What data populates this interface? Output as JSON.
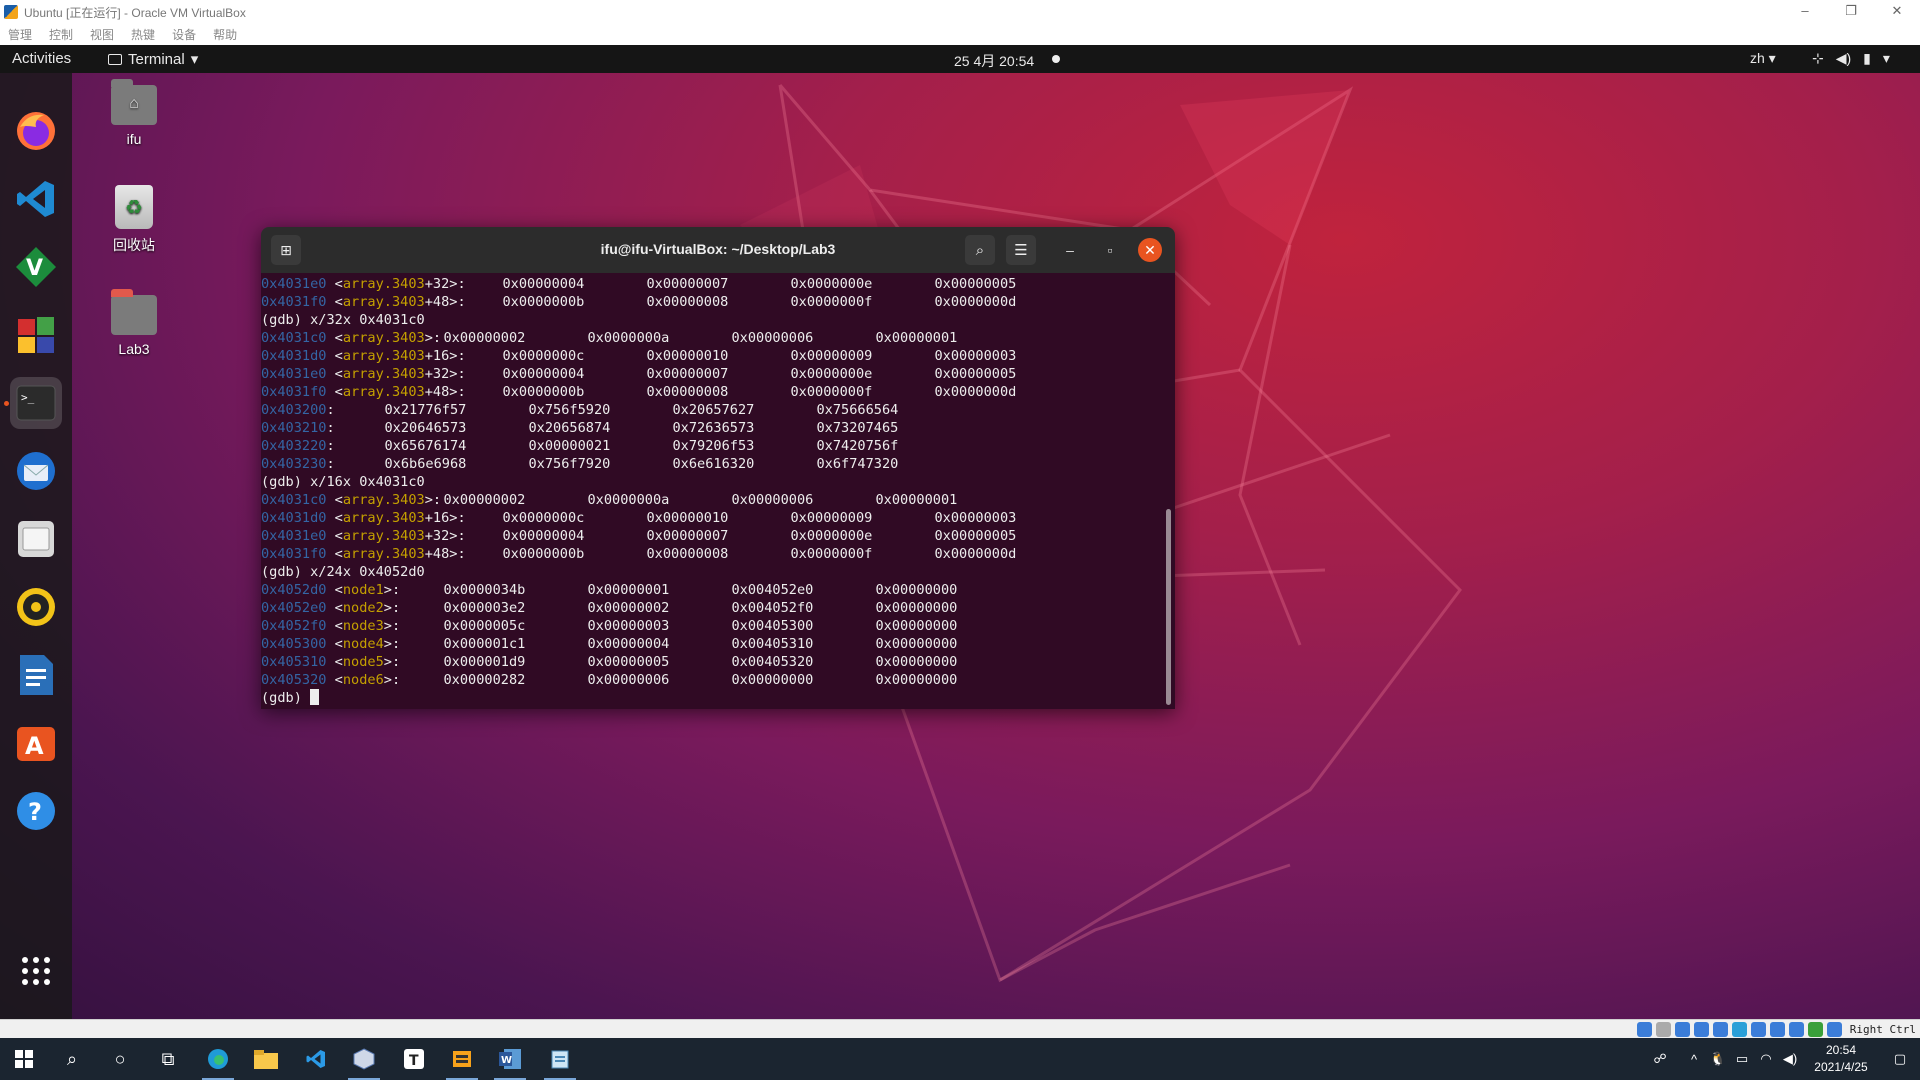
{
  "vbox": {
    "title": "Ubuntu [正在运行] - Oracle VM VirtualBox",
    "menu": [
      "管理",
      "控制",
      "视图",
      "热键",
      "设备",
      "帮助"
    ],
    "window_buttons": {
      "minimize": "–",
      "restore": "❐",
      "close": "✕"
    }
  },
  "topbar": {
    "activities": "Activities",
    "app_menu": "Terminal",
    "clock": "25 4月  20:54",
    "lang": "zh"
  },
  "dock": {
    "items": [
      "firefox-icon",
      "vscode-icon",
      "vim-icon",
      "office-icon",
      "terminal-icon",
      "thunderbird-icon",
      "files-icon",
      "rhythmbox-icon",
      "writer-icon",
      "software-icon",
      "help-icon",
      "show-apps-icon"
    ]
  },
  "desktop": {
    "icons": [
      {
        "label": "ifu"
      },
      {
        "label": "回收站"
      },
      {
        "label": "Lab3"
      }
    ]
  },
  "terminal": {
    "title": "ifu@ifu-VirtualBox: ~/Desktop/Lab3",
    "lines": [
      {
        "addr": "0x4031e0",
        "sym": "array.3403",
        "off": "+32",
        "vals": [
          "0x00000004",
          "0x00000007",
          "0x0000000e",
          "0x00000005"
        ]
      },
      {
        "addr": "0x4031f0",
        "sym": "array.3403",
        "off": "+48",
        "vals": [
          "0x0000000b",
          "0x00000008",
          "0x0000000f",
          "0x0000000d"
        ]
      },
      {
        "cmd": "(gdb) x/32x 0x4031c0"
      },
      {
        "addr": "0x4031c0",
        "sym": "array.3403",
        "off": "",
        "vals": [
          "0x00000002",
          "0x0000000a",
          "0x00000006",
          "0x00000001"
        ]
      },
      {
        "addr": "0x4031d0",
        "sym": "array.3403",
        "off": "+16",
        "vals": [
          "0x0000000c",
          "0x00000010",
          "0x00000009",
          "0x00000003"
        ]
      },
      {
        "addr": "0x4031e0",
        "sym": "array.3403",
        "off": "+32",
        "vals": [
          "0x00000004",
          "0x00000007",
          "0x0000000e",
          "0x00000005"
        ]
      },
      {
        "addr": "0x4031f0",
        "sym": "array.3403",
        "off": "+48",
        "vals": [
          "0x0000000b",
          "0x00000008",
          "0x0000000f",
          "0x0000000d"
        ]
      },
      {
        "addr": "0x403200",
        "plain": true,
        "vals": [
          "0x21776f57",
          "0x756f5920",
          "0x20657627",
          "0x75666564"
        ]
      },
      {
        "addr": "0x403210",
        "plain": true,
        "vals": [
          "0x20646573",
          "0x20656874",
          "0x72636573",
          "0x73207465"
        ]
      },
      {
        "addr": "0x403220",
        "plain": true,
        "vals": [
          "0x65676174",
          "0x00000021",
          "0x79206f53",
          "0x7420756f"
        ]
      },
      {
        "addr": "0x403230",
        "plain": true,
        "vals": [
          "0x6b6e6968",
          "0x756f7920",
          "0x6e616320",
          "0x6f747320"
        ]
      },
      {
        "cmd": "(gdb) x/16x 0x4031c0"
      },
      {
        "addr": "0x4031c0",
        "sym": "array.3403",
        "off": "",
        "vals": [
          "0x00000002",
          "0x0000000a",
          "0x00000006",
          "0x00000001"
        ]
      },
      {
        "addr": "0x4031d0",
        "sym": "array.3403",
        "off": "+16",
        "vals": [
          "0x0000000c",
          "0x00000010",
          "0x00000009",
          "0x00000003"
        ]
      },
      {
        "addr": "0x4031e0",
        "sym": "array.3403",
        "off": "+32",
        "vals": [
          "0x00000004",
          "0x00000007",
          "0x0000000e",
          "0x00000005"
        ]
      },
      {
        "addr": "0x4031f0",
        "sym": "array.3403",
        "off": "+48",
        "vals": [
          "0x0000000b",
          "0x00000008",
          "0x0000000f",
          "0x0000000d"
        ]
      },
      {
        "cmd": "(gdb) x/24x 0x4052d0"
      },
      {
        "addr": "0x4052d0",
        "sym": "node1",
        "off": "",
        "vals": [
          "0x0000034b",
          "0x00000001",
          "0x004052e0",
          "0x00000000"
        ]
      },
      {
        "addr": "0x4052e0",
        "sym": "node2",
        "off": "",
        "vals": [
          "0x000003e2",
          "0x00000002",
          "0x004052f0",
          "0x00000000"
        ]
      },
      {
        "addr": "0x4052f0",
        "sym": "node3",
        "off": "",
        "vals": [
          "0x0000005c",
          "0x00000003",
          "0x00405300",
          "0x00000000"
        ]
      },
      {
        "addr": "0x405300",
        "sym": "node4",
        "off": "",
        "vals": [
          "0x000001c1",
          "0x00000004",
          "0x00405310",
          "0x00000000"
        ]
      },
      {
        "addr": "0x405310",
        "sym": "node5",
        "off": "",
        "vals": [
          "0x000001d9",
          "0x00000005",
          "0x00405320",
          "0x00000000"
        ]
      },
      {
        "addr": "0x405320",
        "sym": "node6",
        "off": "",
        "vals": [
          "0x00000282",
          "0x00000006",
          "0x00000000",
          "0x00000000"
        ]
      }
    ],
    "prompt": "(gdb) "
  },
  "statusbar": {
    "hostkey": "Right Ctrl"
  },
  "taskbar": {
    "time": "20:54",
    "date": "2021/4/25"
  },
  "colors": {
    "terminal_bg": "#300a24",
    "address": "#3465a4",
    "symbol": "#c4a000",
    "close_button": "#e95420"
  }
}
